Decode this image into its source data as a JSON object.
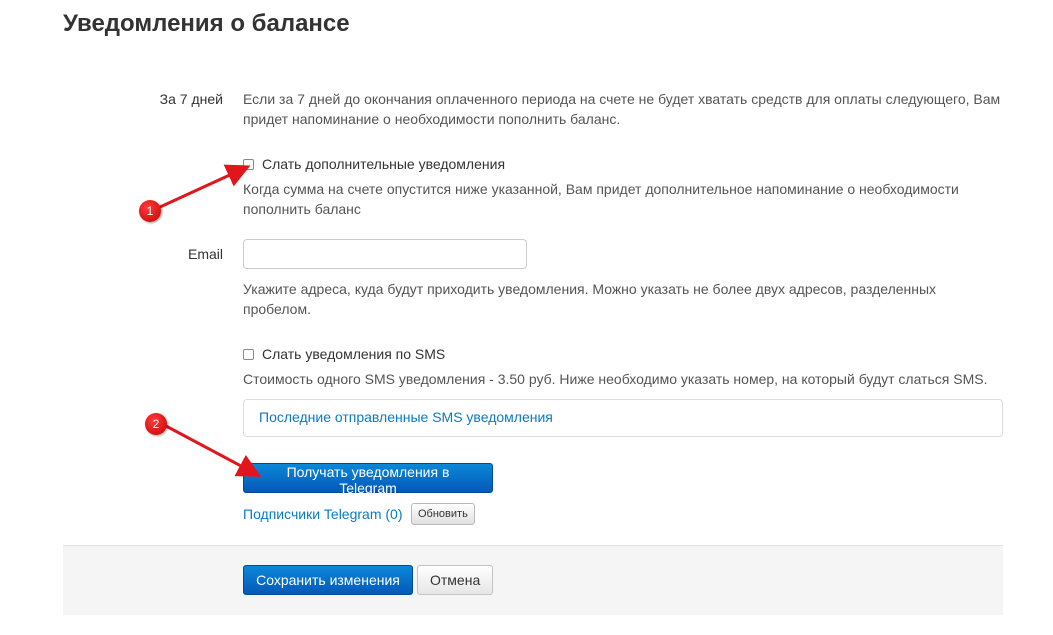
{
  "page": {
    "title": "Уведомления о балансе"
  },
  "seven_days": {
    "label": "За 7 дней",
    "description": "Если за 7 дней до окончания оплаченного периода на счете не будет хватать средств для оплаты следующего, Вам придет напоминание о необходимости пополнить баланс."
  },
  "extra_notifications": {
    "label": "Слать дополнительные уведомления",
    "checked": false,
    "description": "Когда сумма на счете опустится ниже указанной, Вам придет дополнительное напоминание о необходимости пополнить баланс"
  },
  "email": {
    "label": "Email",
    "value": "",
    "placeholder": "",
    "hint": "Укажите адреса, куда будут приходить уведомления. Можно указать не более двух адресов, разделенных пробелом."
  },
  "sms": {
    "label": "Слать уведомления по SMS",
    "checked": false,
    "description": "Стоимость одного SMS уведомления - 3.50 руб. Ниже необходимо указать номер, на который будут слаться SMS.",
    "last_sent_link": "Последние отправленные SMS уведомления"
  },
  "telegram": {
    "button_label": "Получать уведомления в Telegram",
    "subscribers_link": "Подписчики Telegram (0)",
    "refresh_label": "Обновить"
  },
  "footer": {
    "save_label": "Сохранить изменения",
    "cancel_label": "Отмена"
  },
  "annotations": {
    "marker_1": "1",
    "marker_2": "2",
    "color": "#e0161c"
  },
  "colors": {
    "link": "#0a7cc0",
    "primary_button": "#0558b8",
    "footer_background": "#f5f5f5"
  }
}
